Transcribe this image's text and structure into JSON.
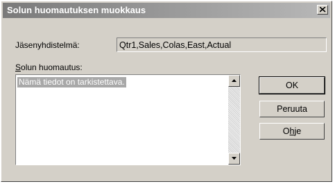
{
  "dialog": {
    "title": "Solun huomautuksen muokkaus",
    "close_symbol": "×"
  },
  "member_combination": {
    "label": "Jäsenyhdistelmä:",
    "value": "Qtr1,Sales,Colas,East,Actual"
  },
  "cell_note": {
    "label_first": "S",
    "label_rest": "olun huomautus:",
    "value": "Nämä tiedot on tarkistettava."
  },
  "buttons": {
    "ok": "OK",
    "cancel": "Peruuta",
    "help_first": "O",
    "help_underlined": "h",
    "help_rest": "je"
  },
  "icons": {
    "close": "close-icon",
    "scroll_up": "scroll-up-arrow-icon",
    "scroll_down": "scroll-down-arrow-icon"
  }
}
